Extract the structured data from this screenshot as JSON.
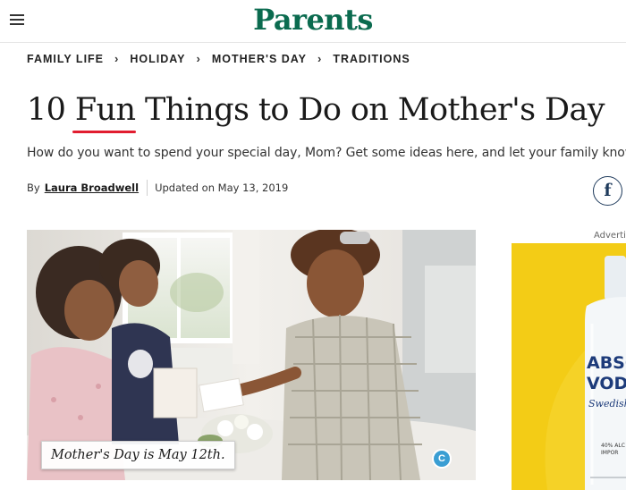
{
  "header": {
    "logo": "Parents",
    "menu_icon": "hamburger-menu-icon"
  },
  "breadcrumb": [
    {
      "label": "FAMILY LIFE"
    },
    {
      "label": "HOLIDAY"
    },
    {
      "label": "MOTHER'S DAY"
    },
    {
      "label": "TRADITIONS"
    }
  ],
  "article": {
    "title_prefix": "10 ",
    "title_highlight": "Fun",
    "title_suffix": " Things to Do on Mother's Day",
    "subtitle": "How do you want to spend your special day, Mom? Get some ideas here, and let your family know.",
    "byline_prefix": "By",
    "author": "Laura Broadwell",
    "updated": "Updated on May 13, 2019",
    "share_icon": "facebook-icon",
    "image_caption": "Mother's Day is May 12th.",
    "image_badge": "C"
  },
  "ad": {
    "label": "Advertis",
    "brand_line1": "ABSO",
    "brand_line2": "VOD",
    "brand_line3": "Swedish",
    "abv": "40% ALC",
    "import": "IMPOR"
  },
  "colors": {
    "brand_green": "#0b6b4f",
    "highlight_red": "#e11d2f",
    "facebook_navy": "#1f3b5c",
    "ad_yellow": "#f3cc16"
  }
}
